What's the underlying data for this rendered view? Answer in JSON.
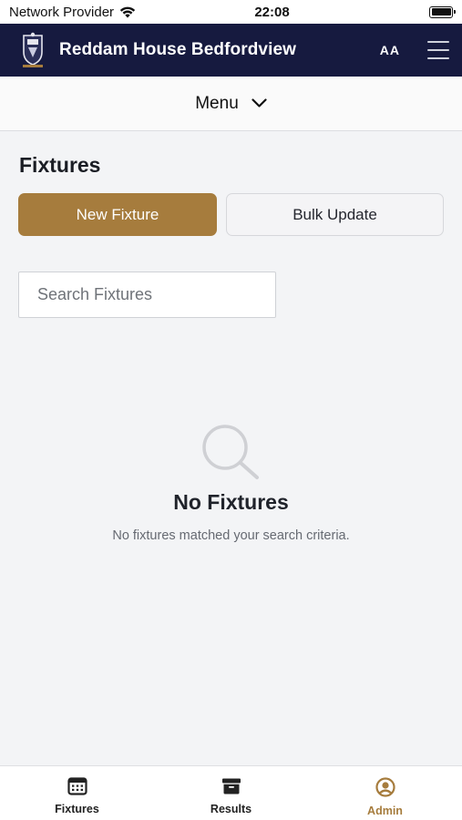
{
  "status_bar": {
    "carrier": "Network Provider",
    "time": "22:08"
  },
  "header": {
    "title": "Reddam House Bedfordview",
    "text_size_label": "AA"
  },
  "menu": {
    "label": "Menu"
  },
  "page": {
    "title": "Fixtures",
    "new_button": "New Fixture",
    "bulk_button": "Bulk Update",
    "search_placeholder": "Search Fixtures",
    "search_value": ""
  },
  "empty_state": {
    "icon": "search-icon",
    "title": "No Fixtures",
    "message": "No fixtures matched your search criteria."
  },
  "bottom_nav": {
    "items": [
      {
        "label": "Fixtures",
        "icon": "calendar-icon",
        "active": false
      },
      {
        "label": "Results",
        "icon": "archive-icon",
        "active": false
      },
      {
        "label": "Admin",
        "icon": "user-circle-icon",
        "active": true
      }
    ]
  },
  "colors": {
    "header_bg": "#161a3f",
    "accent": "#a67c3d",
    "page_bg": "#f3f4f6"
  }
}
